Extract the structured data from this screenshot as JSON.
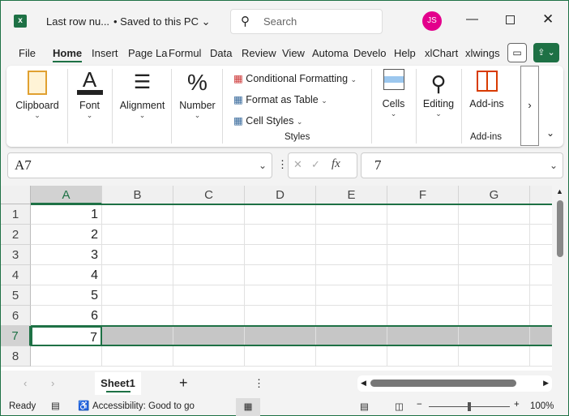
{
  "title": {
    "doc": "Last row nu...",
    "saved": "• Saved to this PC ⌄",
    "search_placeholder": "Search",
    "avatar": "JS",
    "accent": "#1e7145",
    "avatar_color": "#e3008c"
  },
  "tabs": [
    "File",
    "Home",
    "Insert",
    "Page La",
    "Formul",
    "Data",
    "Review",
    "View",
    "Automa",
    "Develo",
    "Help",
    "xlChart",
    "xlwings"
  ],
  "ribbon": {
    "clipboard": "Clipboard",
    "font": "Font",
    "alignment": "Alignment",
    "number": "Number",
    "cond_fmt": "Conditional Formatting",
    "fmt_table": "Format as Table",
    "cell_styles": "Cell Styles",
    "styles": "Styles",
    "cells": "Cells",
    "editing": "Editing",
    "addins": "Add-ins",
    "addins_group": "Add-ins"
  },
  "formula": {
    "name_box": "A7",
    "fx": "fx",
    "value": "7"
  },
  "columns": [
    "A",
    "B",
    "C",
    "D",
    "E",
    "F",
    "G"
  ],
  "rows": [
    "1",
    "2",
    "3",
    "4",
    "5",
    "6",
    "7",
    "8"
  ],
  "values": [
    "1",
    "2",
    "3",
    "4",
    "5",
    "6",
    "7",
    ""
  ],
  "sheet": {
    "tab": "Sheet1",
    "add": "+"
  },
  "status": {
    "ready": "Ready",
    "accessibility": "Accessibility: Good to go",
    "zoom": "100%"
  }
}
